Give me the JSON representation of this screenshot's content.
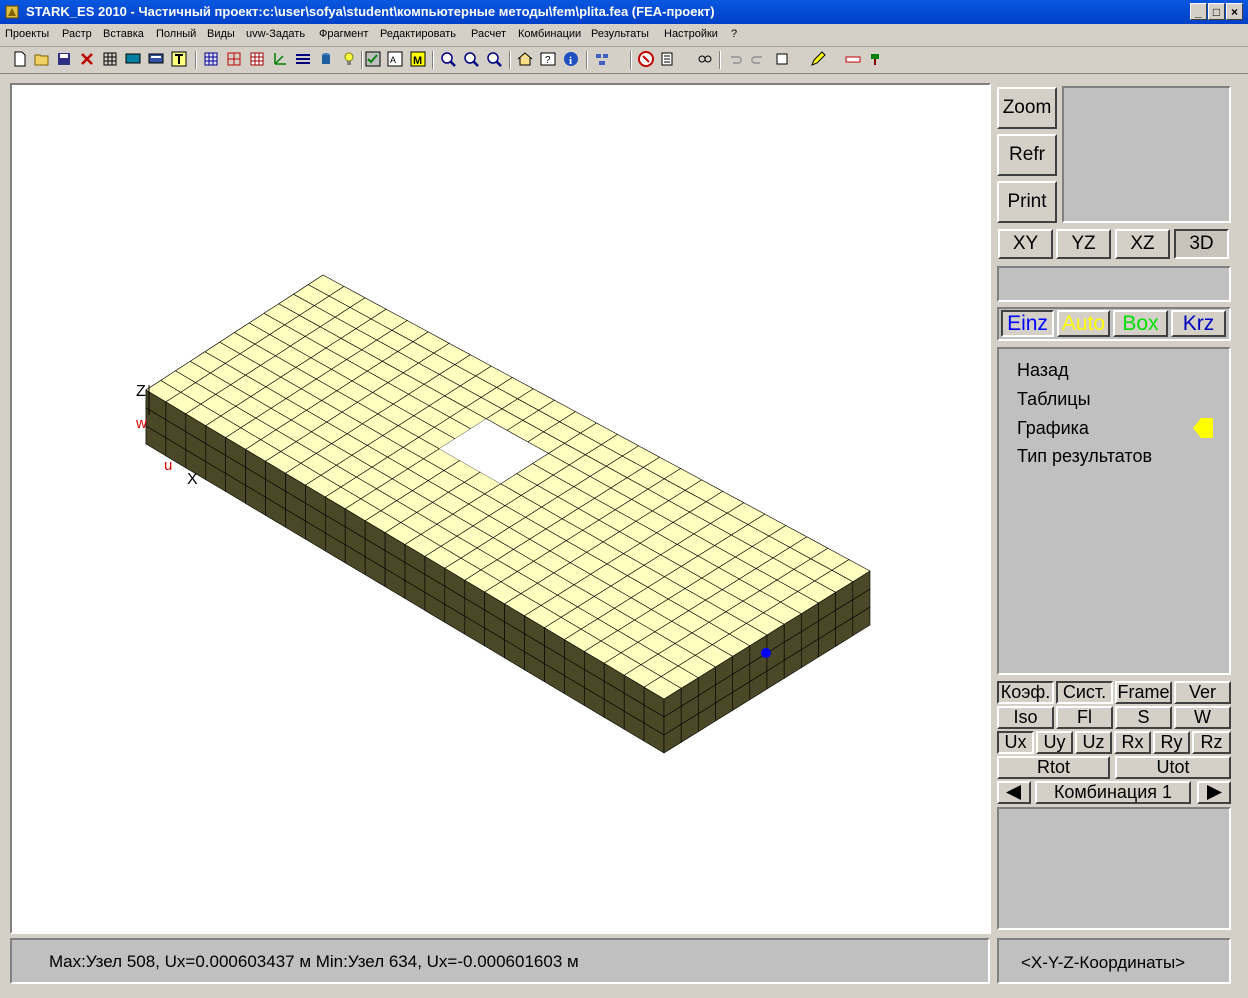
{
  "window": {
    "title": "STARK_ES 2010 - Частичный проект:c:\\user\\sofya\\student\\компьютерные методы\\fem\\plita.fea  (FEA-проект)",
    "minimize": "_",
    "maximize": "□",
    "close": "×"
  },
  "menu": [
    "Проекты",
    "Растр",
    "Вставка",
    "Полный",
    "Виды",
    "uvw-Задать",
    "Фрагмент",
    "Редактировать",
    "Расчет",
    "Комбинации",
    "Результаты",
    "Настройки",
    "?"
  ],
  "toolbar_icons": [
    "new-icon",
    "open-icon",
    "save-icon",
    "delete-icon",
    "grid-icon",
    "screen-icon",
    "display-icon",
    "text-icon",
    "mesh-icon",
    "mesh-add-icon",
    "table-icon",
    "axes-icon",
    "layers-icon",
    "cylinder-icon",
    "bulb-icon",
    "check-icon",
    "text-box-icon",
    "m-icon",
    "zoom-in-icon",
    "zoom-out-icon",
    "zoom-fit-icon",
    "home-icon",
    "help-icon",
    "info-icon",
    "mf-icon",
    "stop-icon",
    "config-icon",
    "link-icon",
    "undo-icon",
    "redo-icon",
    "view-icon",
    "pencil-icon",
    "ruler-icon",
    "paint-icon"
  ],
  "viewport": {
    "axis_z": "Z",
    "axis_w": "w",
    "axis_u": "u",
    "axis_x": "X"
  },
  "right_panel": {
    "zoom": "Zoom",
    "refr": "Refr",
    "print": "Print",
    "views": [
      "XY",
      "YZ",
      "XZ",
      "3D"
    ],
    "modes": [
      {
        "label": "Einz",
        "color": "#0000ff"
      },
      {
        "label": "Auto",
        "color": "#ffff00"
      },
      {
        "label": "Box",
        "color": "#00e000"
      },
      {
        "label": "Krz",
        "color": "#0000c0"
      }
    ],
    "menu_items": [
      "Назад",
      "Таблицы",
      "Графика",
      "Тип результатов"
    ],
    "row1": [
      "Коэф.",
      "Сист.",
      "Frame",
      "Ver"
    ],
    "row2": [
      "Iso",
      "Fl",
      "S",
      "W"
    ],
    "row3": [
      "Ux",
      "Uy",
      "Uz",
      "Rx",
      "Ry",
      "Rz"
    ],
    "row4": [
      "Rtot",
      "Utot"
    ],
    "combination": "Комбинация 1"
  },
  "status": {
    "main": "Max:Узел 508, Ux=0.000603437 м Min:Узел 634, Ux=-0.000601603 м",
    "coords": "<X-Y-Z-Координаты>"
  },
  "colors": {
    "top_face": "#ffffc0",
    "side_face": "#4a4826",
    "title_bar": "#0a58e0",
    "arrow": "#ffff00"
  }
}
